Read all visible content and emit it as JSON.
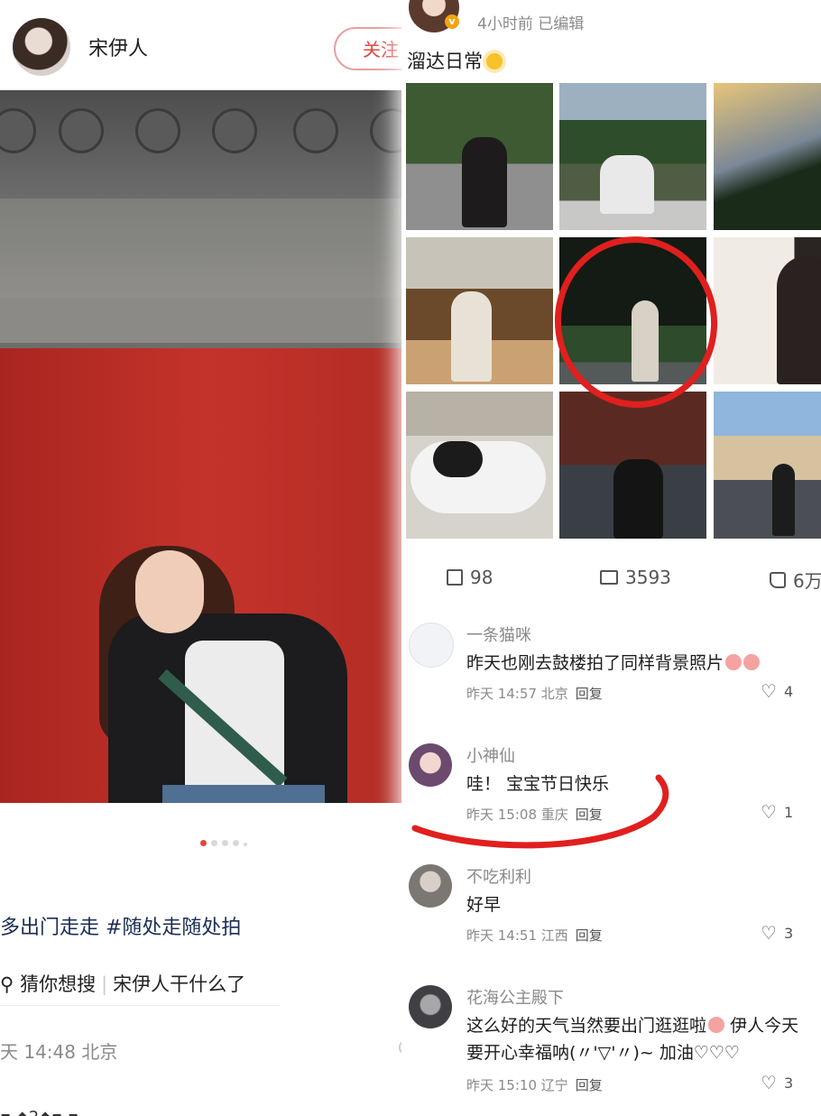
{
  "left_post": {
    "user_name": "宋伊人",
    "follow_label": "关注",
    "tags_text": "多出门走走 #随处走随处拍",
    "search_icon": "search-icon",
    "search_prefix": "猜你想搜",
    "search_suggestion": "宋伊人干什么了",
    "time_location": "天 14:48 北京",
    "bottom_cut_text": "▪ ◆2◆▪ ▪"
  },
  "right_post": {
    "meta": "4小时前  已编辑",
    "verified_badge": "v",
    "text": "溜达日常",
    "stats": {
      "shares": "98",
      "comments": "3593",
      "likes": "6万"
    },
    "comments": [
      {
        "user": "一条猫咪",
        "text": "昨天也刚去鼓楼拍了同样背景照片",
        "time": "昨天 14:57 北京",
        "reply": "回复",
        "likes": "4"
      },
      {
        "user": "小神仙",
        "text": "哇！ 宝宝节日快乐",
        "time": "昨天 15:08 重庆",
        "reply": "回复",
        "likes": "1"
      },
      {
        "user": "不吃利利",
        "text": "好早",
        "time": "昨天 14:51 江西",
        "reply": "回复",
        "likes": "3"
      },
      {
        "user": "花海公主殿下",
        "text1": "这么好的天气当然要出门逛逛啦",
        "text1b": "伊人今天",
        "text2": "要开心幸福呐(〃'▽'〃)~ 加油♡♡♡",
        "time": "昨天 15:10 辽宁",
        "reply": "回复",
        "likes": "3"
      }
    ]
  },
  "colors": {
    "accent_red": "#e0453f",
    "annotation_red": "#e0201e"
  }
}
